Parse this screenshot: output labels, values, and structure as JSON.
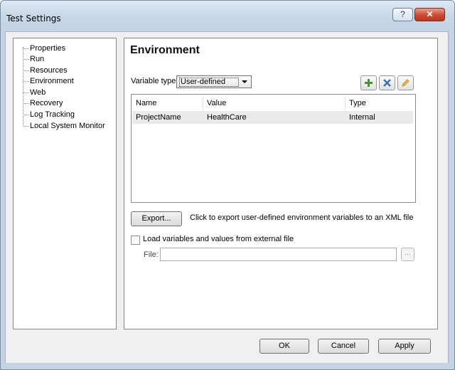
{
  "window": {
    "title": "Test Settings",
    "help_label": "?",
    "close_label": "✕"
  },
  "tree": {
    "items": [
      {
        "label": "Properties"
      },
      {
        "label": "Run"
      },
      {
        "label": "Resources"
      },
      {
        "label": "Environment"
      },
      {
        "label": "Web"
      },
      {
        "label": "Recovery"
      },
      {
        "label": "Log Tracking"
      },
      {
        "label": "Local System Monitor"
      }
    ]
  },
  "environment": {
    "heading": "Environment",
    "variable_type_label": "Variable type:",
    "variable_type_value": "User-defined",
    "icons": {
      "add": "plus-icon",
      "delete": "delete-icon",
      "edit": "pencil-icon"
    },
    "table": {
      "columns": [
        "Name",
        "Value",
        "Type"
      ],
      "rows": [
        {
          "name": "ProjectName",
          "value": "HealthCare",
          "type": "Internal"
        }
      ]
    },
    "export_button": "Export...",
    "export_description": "Click to export user-defined environment variables to an XML file",
    "load_checkbox_label": "Load variables and values from external file",
    "load_checked": false,
    "file_label": "File:",
    "file_value": "",
    "browse_label": "..."
  },
  "footer": {
    "ok": "OK",
    "cancel": "Cancel",
    "apply": "Apply"
  },
  "colors": {
    "frame": "#c3d3e4",
    "close_button": "#c8492f",
    "add_icon": "#3c9a2a",
    "delete_icon": "#3b6fb3",
    "edit_icon": "#c98a12"
  }
}
